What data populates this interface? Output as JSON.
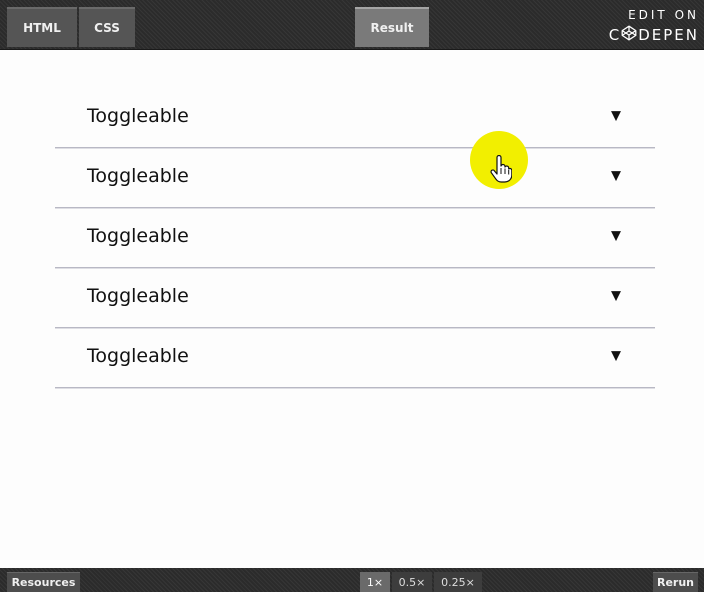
{
  "tabs": {
    "html": "HTML",
    "css": "CSS",
    "result": "Result"
  },
  "brand": {
    "edit_on": "EDIT ON",
    "name_before_logo": "C",
    "name_after_logo": "DEPEN"
  },
  "accordion": {
    "items": [
      {
        "label": "Toggleable",
        "arrow": "▼"
      },
      {
        "label": "Toggleable",
        "arrow": "▼"
      },
      {
        "label": "Toggleable",
        "arrow": "▼"
      },
      {
        "label": "Toggleable",
        "arrow": "▼"
      },
      {
        "label": "Toggleable",
        "arrow": "▼"
      }
    ]
  },
  "footer": {
    "resources": "Resources",
    "zoom_1": "1×",
    "zoom_05": "0.5×",
    "zoom_025": "0.25×",
    "rerun": "Rerun"
  },
  "colors": {
    "cursor_highlight": "#f2ef00",
    "toolbar_bg": "#2b2b2b"
  },
  "icons": {
    "cursor": "hand-pointer-icon",
    "logo": "codepen-logo-icon",
    "arrow": "triangle-down-icon"
  }
}
